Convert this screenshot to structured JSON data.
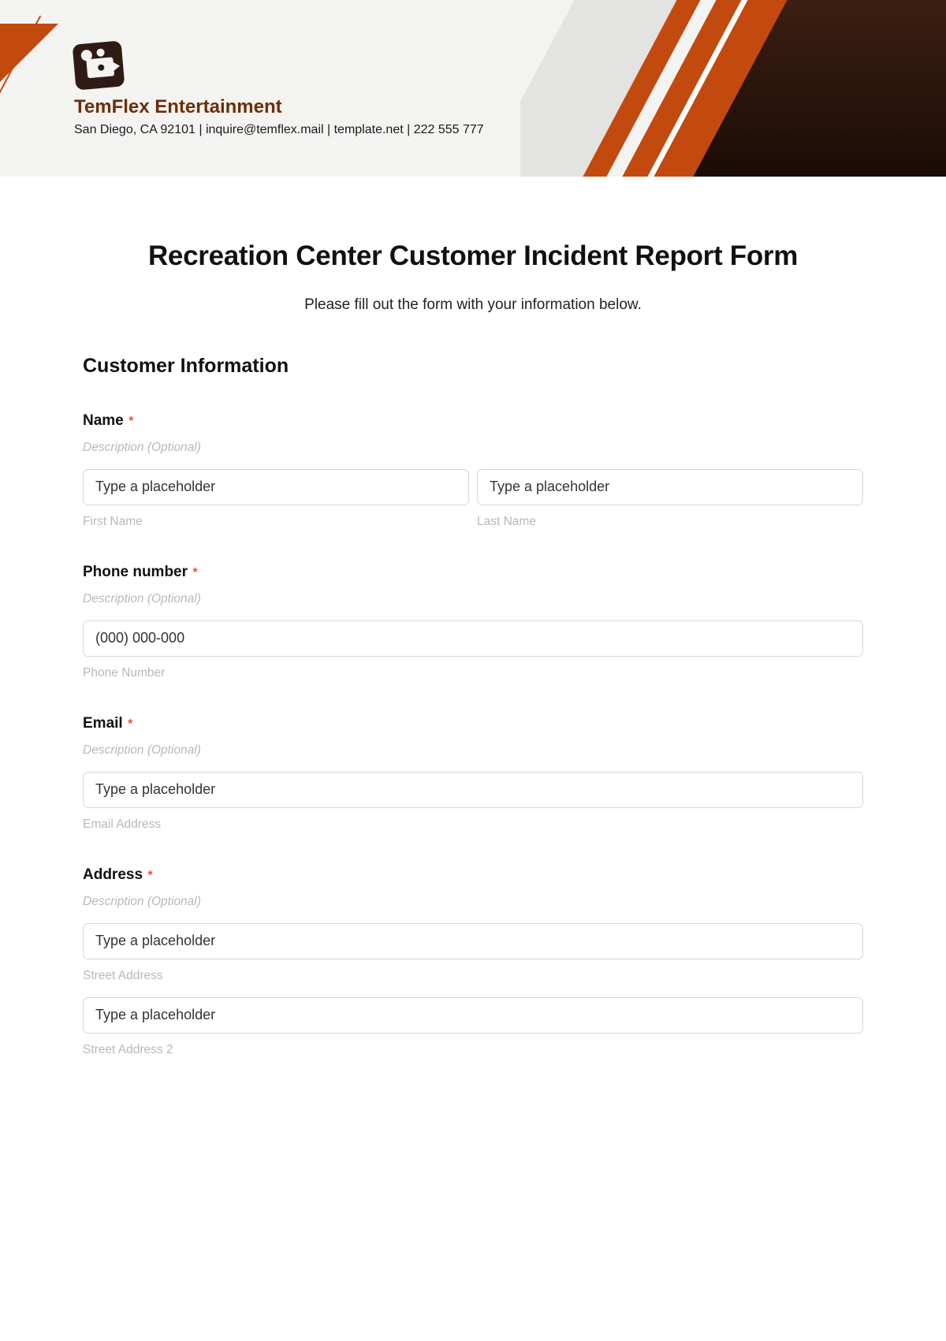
{
  "header": {
    "company_name": "TemFlex Entertainment",
    "company_line": "San Diego, CA 92101 | inquire@temflex.mail | template.net | 222 555 777"
  },
  "form": {
    "title": "Recreation Center Customer Incident Report Form",
    "subtitle": "Please fill out the form with your information below.",
    "section_title": "Customer Information",
    "name": {
      "label": "Name",
      "required": "*",
      "desc": "Description (Optional)",
      "first_placeholder": "Type a placeholder",
      "first_sub": "First Name",
      "last_placeholder": "Type a placeholder",
      "last_sub": "Last Name"
    },
    "phone": {
      "label": "Phone number",
      "required": "*",
      "desc": "Description (Optional)",
      "placeholder": "(000) 000-000",
      "sub": "Phone Number"
    },
    "email": {
      "label": "Email",
      "required": "*",
      "desc": "Description (Optional)",
      "placeholder": "Type a placeholder",
      "sub": "Email Address"
    },
    "address": {
      "label": "Address",
      "required": "*",
      "desc": "Description (Optional)",
      "street_placeholder": "Type a placeholder",
      "street_sub": "Street Address",
      "street2_placeholder": "Type a placeholder",
      "street2_sub": "Street Address 2"
    }
  }
}
